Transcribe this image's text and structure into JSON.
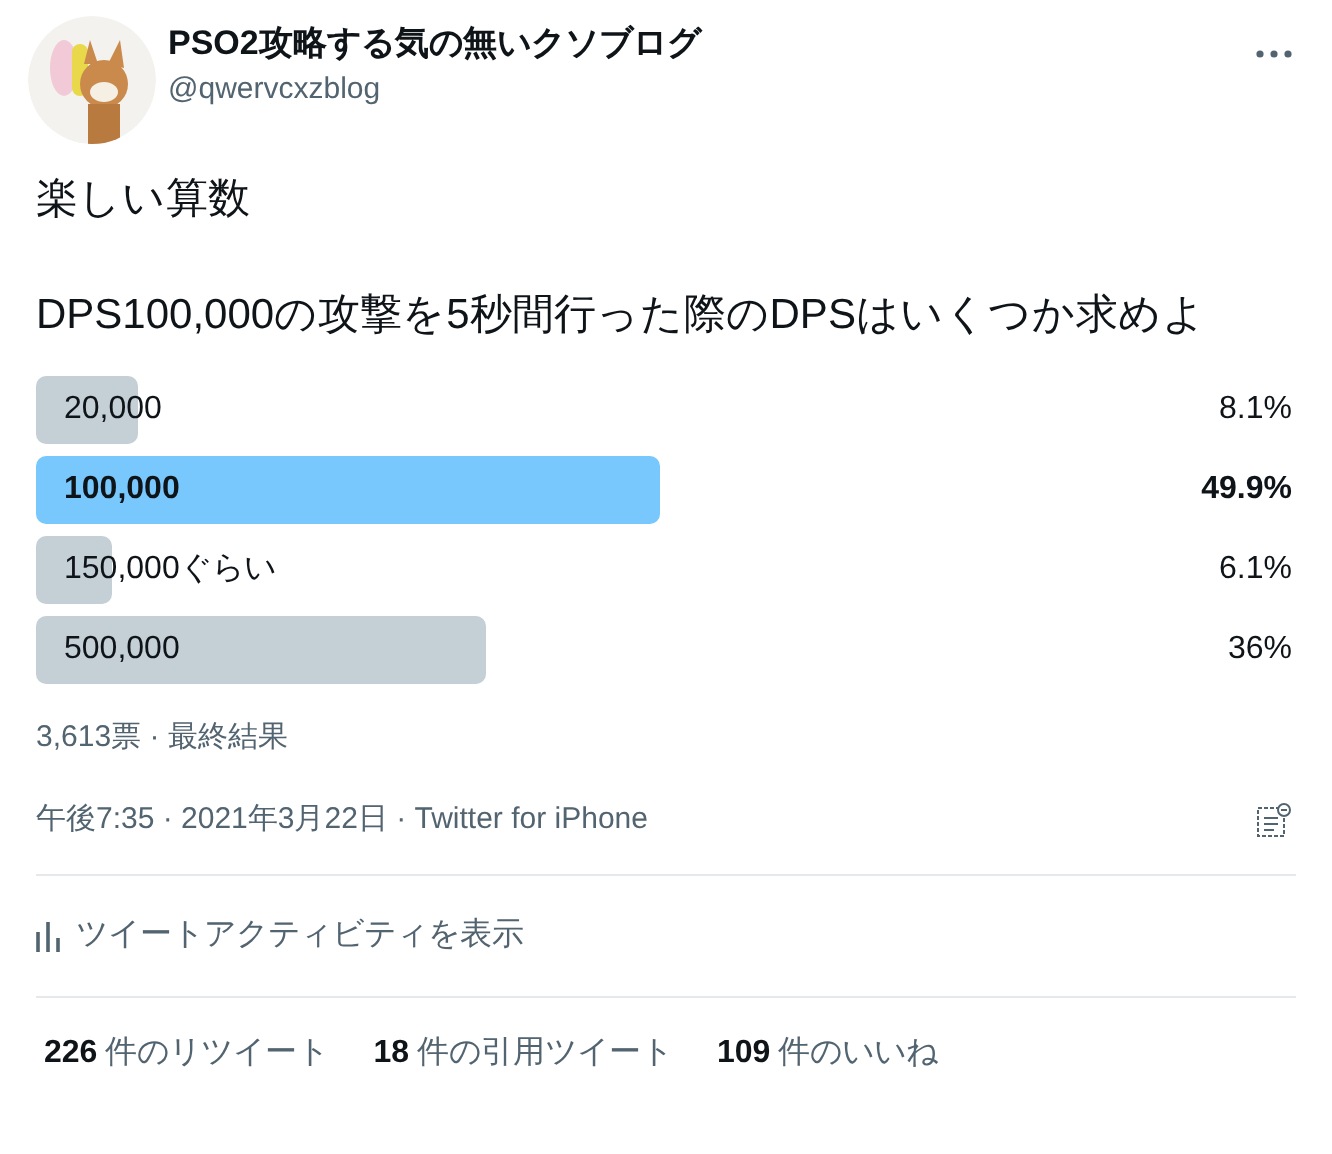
{
  "author": {
    "name": "PSO2攻略する気の無いクソブログ",
    "handle": "@qwervcxzblog"
  },
  "text": [
    "楽しい算数",
    "DPS100,000の攻撃を5秒間行った際のDPSはいくつか求めよ"
  ],
  "poll": {
    "options": [
      {
        "label": "20,000",
        "percent": "8.1%",
        "selected": false
      },
      {
        "label": "100,000",
        "percent": "49.9%",
        "selected": true
      },
      {
        "label": "150,000ぐらい",
        "percent": "6.1%",
        "selected": false
      },
      {
        "label": "500,000",
        "percent": "36%",
        "selected": false
      }
    ],
    "summary": "3,613票 · 最終結果"
  },
  "meta": "午後7:35 · 2021年3月22日 · Twitter for iPhone",
  "activity": "ツイートアクティビティを表示",
  "stats": [
    {
      "count": "226",
      "label": "件のリツイート"
    },
    {
      "count": "18",
      "label": "件の引用ツイート"
    },
    {
      "count": "109",
      "label": "件のいいね"
    }
  ]
}
